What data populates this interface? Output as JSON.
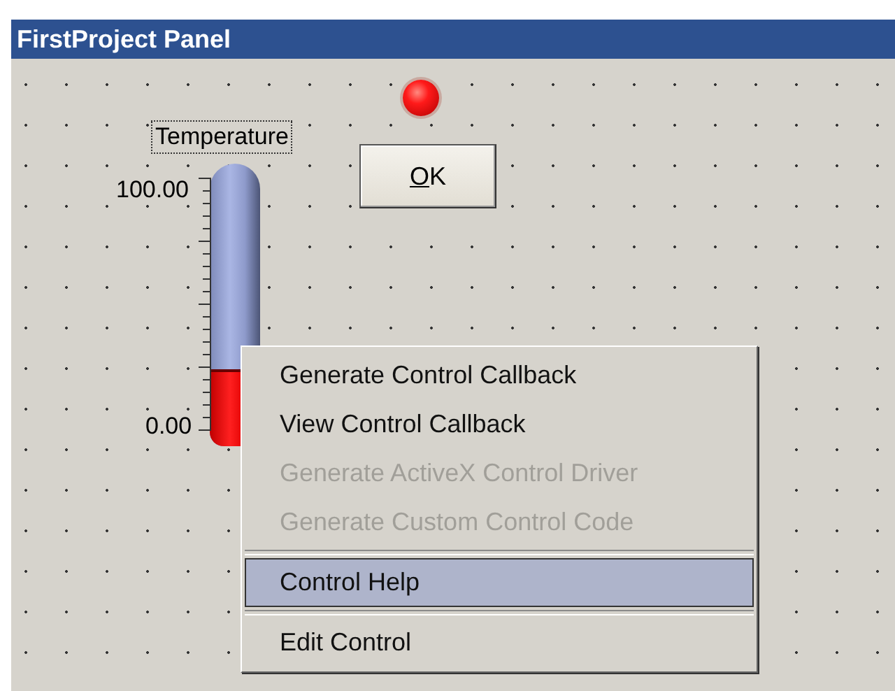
{
  "window": {
    "title": "FirstProject Panel"
  },
  "led": {
    "on": true
  },
  "thermometer": {
    "label": "Temperature",
    "max_label": "100.00",
    "min_label": "0.00",
    "level": 0.24
  },
  "button": {
    "label": "OK"
  },
  "context_menu": {
    "items": [
      {
        "kind": "item",
        "label": "Generate Control Callback",
        "disabled": false,
        "selected": false
      },
      {
        "kind": "item",
        "label": "View Control Callback",
        "disabled": false,
        "selected": false
      },
      {
        "kind": "item",
        "label": "Generate ActiveX Control Driver",
        "disabled": true,
        "selected": false
      },
      {
        "kind": "item",
        "label": "Generate Custom Control Code",
        "disabled": true,
        "selected": false
      },
      {
        "kind": "separator"
      },
      {
        "kind": "item",
        "label": "Control Help",
        "disabled": false,
        "selected": true
      },
      {
        "kind": "separator"
      },
      {
        "kind": "item",
        "label": "Edit Control",
        "disabled": false,
        "selected": false
      }
    ]
  }
}
